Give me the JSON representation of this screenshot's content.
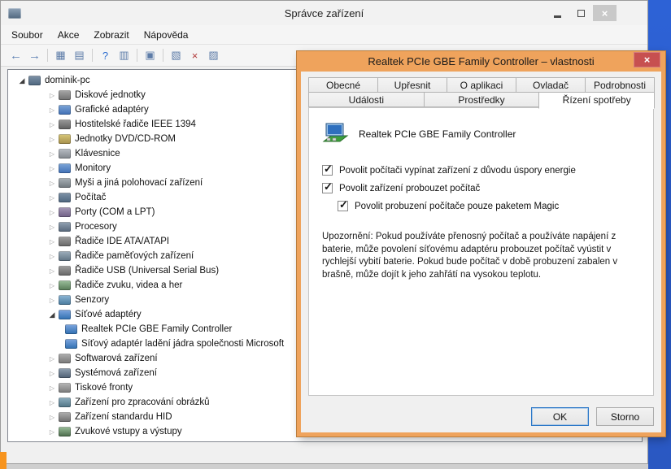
{
  "colors": {
    "dialog_accent": "#efa35c",
    "dialog_close_red": "#c75050",
    "desktop_blue": "#2d62d6",
    "desktop_orange": "#f7941e",
    "focus_blue": "#2c78c8"
  },
  "main_window": {
    "title": "Správce zařízení",
    "menu": [
      "Soubor",
      "Akce",
      "Zobrazit",
      "Nápověda"
    ],
    "toolbar_groups": [
      [
        "back",
        "forward"
      ],
      [
        "console-tree",
        "export-list"
      ],
      [
        "help",
        "properties"
      ],
      [
        "scan-hardware-changes"
      ],
      [
        "update-driver",
        "uninstall-device",
        "disable-device"
      ]
    ],
    "tree": [
      {
        "label": "dominik-pc",
        "icon": "computer",
        "state": "expanded",
        "level": 0
      },
      {
        "label": "Diskové jednotky",
        "icon": "disk-drive",
        "state": "collapsed",
        "level": 1
      },
      {
        "label": "Grafické adaptéry",
        "icon": "display-adapter",
        "state": "collapsed",
        "level": 1
      },
      {
        "label": "Hostitelské řadiče IEEE 1394",
        "icon": "ieee1394",
        "state": "collapsed",
        "level": 1
      },
      {
        "label": "Jednotky DVD/CD-ROM",
        "icon": "dvd-drive",
        "state": "collapsed",
        "level": 1
      },
      {
        "label": "Klávesnice",
        "icon": "keyboard",
        "state": "collapsed",
        "level": 1
      },
      {
        "label": "Monitory",
        "icon": "monitor",
        "state": "collapsed",
        "level": 1
      },
      {
        "label": "Myši a jiná polohovací zařízení",
        "icon": "mouse",
        "state": "collapsed",
        "level": 1
      },
      {
        "label": "Počítač",
        "icon": "computer",
        "state": "collapsed",
        "level": 1
      },
      {
        "label": "Porty (COM a LPT)",
        "icon": "ports",
        "state": "collapsed",
        "level": 1
      },
      {
        "label": "Procesory",
        "icon": "processor",
        "state": "collapsed",
        "level": 1
      },
      {
        "label": "Řadiče IDE ATA/ATAPI",
        "icon": "ide-controller",
        "state": "collapsed",
        "level": 1
      },
      {
        "label": "Řadiče paměťových zařízení",
        "icon": "storage-controller",
        "state": "collapsed",
        "level": 1
      },
      {
        "label": "Řadiče USB (Universal Serial Bus)",
        "icon": "usb-controller",
        "state": "collapsed",
        "level": 1
      },
      {
        "label": "Řadiče zvuku, videa a her",
        "icon": "sound-controller",
        "state": "collapsed",
        "level": 1
      },
      {
        "label": "Senzory",
        "icon": "sensor",
        "state": "collapsed",
        "level": 1
      },
      {
        "label": "Síťové adaptéry",
        "icon": "network-adapter",
        "state": "expanded",
        "level": 1
      },
      {
        "label": "Realtek PCIe GBE Family Controller",
        "icon": "network-adapter",
        "state": "leaf",
        "level": 2
      },
      {
        "label": "Síťový adaptér ladění jádra společnosti Microsoft",
        "icon": "network-adapter",
        "state": "leaf",
        "level": 2
      },
      {
        "label": "Softwarová zařízení",
        "icon": "software-device",
        "state": "collapsed",
        "level": 1
      },
      {
        "label": "Systémová zařízení",
        "icon": "system-device",
        "state": "collapsed",
        "level": 1
      },
      {
        "label": "Tiskové fronty",
        "icon": "print-queue",
        "state": "collapsed",
        "level": 1
      },
      {
        "label": "Zařízení pro zpracování obrázků",
        "icon": "imaging-device",
        "state": "collapsed",
        "level": 1
      },
      {
        "label": "Zařízení standardu HID",
        "icon": "hid-device",
        "state": "collapsed",
        "level": 1
      },
      {
        "label": "Zvukové vstupy a výstupy",
        "icon": "audio-device",
        "state": "collapsed",
        "level": 1
      }
    ]
  },
  "dialog": {
    "title": "Realtek PCIe GBE Family Controller – vlastnosti",
    "tabs_row1": [
      "Obecné",
      "Upřesnit",
      "O aplikaci",
      "Ovladač",
      "Podrobnosti"
    ],
    "tabs_row2": [
      "Události",
      "Prostředky",
      "Řízení spotřeby"
    ],
    "active_tab": "Řízení spotřeby",
    "device_name": "Realtek PCIe GBE Family Controller",
    "checkboxes": [
      {
        "label": "Povolit počítači vypínat zařízení z důvodu úspory energie",
        "checked": true,
        "indent": false
      },
      {
        "label": "Povolit zařízení probouzet počítač",
        "checked": true,
        "indent": false
      },
      {
        "label": "Povolit probuzení počítače pouze paketem Magic",
        "checked": true,
        "indent": true
      }
    ],
    "warning": "Upozornění: Pokud používáte přenosný počítač a používáte napájení z baterie, může povolení síťovému adaptéru probouzet počítač vyústit v rychlejší vybití baterie. Pokud bude počítač v době probuzení zabalen v brašně, může dojít k jeho zahřátí na vysokou teplotu.",
    "buttons": {
      "ok": "OK",
      "cancel": "Storno"
    }
  }
}
